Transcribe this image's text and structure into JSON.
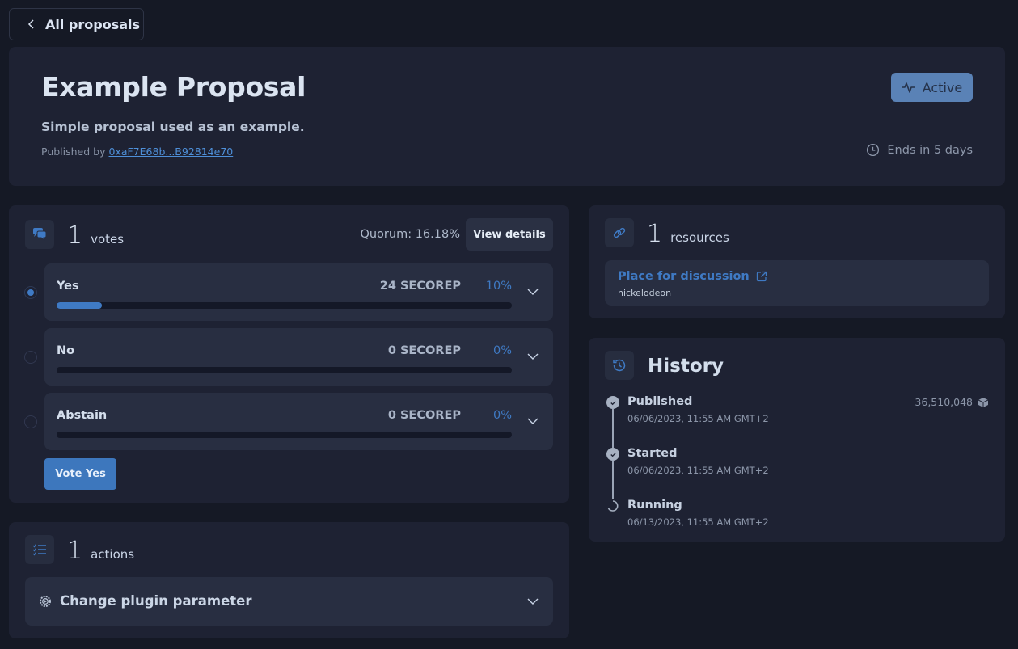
{
  "nav": {
    "back_label": "All proposals"
  },
  "proposal": {
    "title": "Example Proposal",
    "description": "Simple proposal used as an example.",
    "published_by_label": "Published by",
    "publisher_address": "0xaF7E68b...B92814e70",
    "status": "Active",
    "ends_in": "Ends in 5 days"
  },
  "votes": {
    "count": "1",
    "count_label": "votes",
    "quorum": "Quorum: 16.18%",
    "view_details_label": "View details",
    "options": [
      {
        "label": "Yes",
        "amount": "24 SECOREP",
        "percent": "10%",
        "fraction": 0.1,
        "selected": true
      },
      {
        "label": "No",
        "amount": "0 SECOREP",
        "percent": "0%",
        "fraction": 0,
        "selected": false
      },
      {
        "label": "Abstain",
        "amount": "0 SECOREP",
        "percent": "0%",
        "fraction": 0,
        "selected": false
      }
    ],
    "vote_button_label": "Vote Yes"
  },
  "actions": {
    "count": "1",
    "count_label": "actions",
    "items": [
      {
        "label": "Change plugin parameter"
      }
    ]
  },
  "resources": {
    "count": "1",
    "count_label": "resources",
    "items": [
      {
        "label": "Place for discussion",
        "subtitle": "nickelodeon"
      }
    ]
  },
  "history": {
    "title": "History",
    "block_number": "36,510,048",
    "events": [
      {
        "label": "Published",
        "date": "06/06/2023, 11:55 AM GMT+2",
        "state": "done"
      },
      {
        "label": "Started",
        "date": "06/06/2023, 11:55 AM GMT+2",
        "state": "done"
      },
      {
        "label": "Running",
        "date": "06/13/2023, 11:55 AM GMT+2",
        "state": "in-progress"
      }
    ]
  },
  "colors": {
    "background": "#151925",
    "card": "#1e2233",
    "accent": "#3f7ac4",
    "status_badge": "#5a82b6"
  }
}
